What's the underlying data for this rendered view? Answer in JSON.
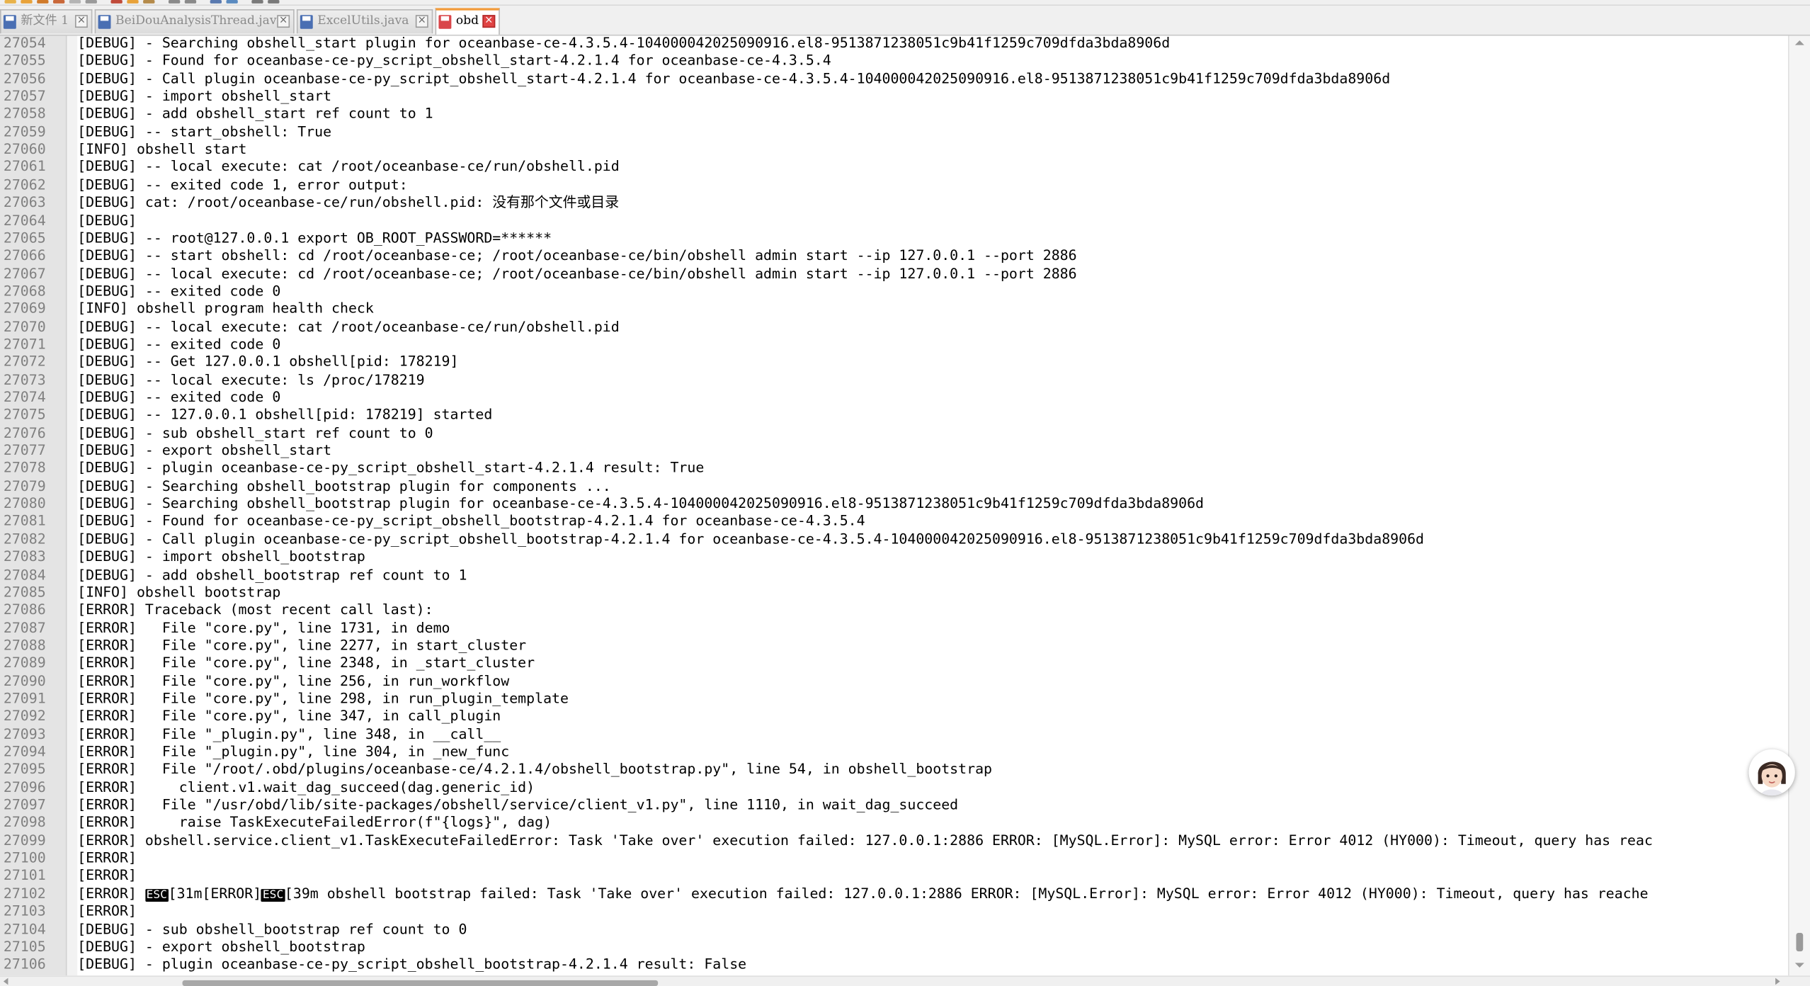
{
  "tabs": [
    {
      "label": "新文件  1",
      "state": "unsaved-icon-saved",
      "icon": "save-disk-icon",
      "active": false
    },
    {
      "label": "BeiDouAnalysisThread.java",
      "icon": "save-disk-icon",
      "active": false
    },
    {
      "label": "ExcelUtils.java",
      "icon": "save-disk-icon",
      "active": false
    },
    {
      "label": "obd",
      "icon": "unsaved-disk-icon",
      "active": true
    }
  ],
  "colors": {
    "active_tab_accent": "#f29b3a",
    "unsaved_icon": "#d9464a",
    "saved_icon": "#4a6fb3",
    "gutter": "#e4e4e4",
    "line_number": "#808080",
    "text": "#000000"
  },
  "esc_label": "ESC",
  "editor": {
    "lines": [
      {
        "n": "27054",
        "text": "[DEBUG] - Searching obshell_start plugin for oceanbase-ce-4.3.5.4-104000042025090916.el8-9513871238051c9b41f1259c709dfda3bda8906d"
      },
      {
        "n": "27055",
        "text": "[DEBUG] - Found for oceanbase-ce-py_script_obshell_start-4.2.1.4 for oceanbase-ce-4.3.5.4"
      },
      {
        "n": "27056",
        "text": "[DEBUG] - Call plugin oceanbase-ce-py_script_obshell_start-4.2.1.4 for oceanbase-ce-4.3.5.4-104000042025090916.el8-9513871238051c9b41f1259c709dfda3bda8906d"
      },
      {
        "n": "27057",
        "text": "[DEBUG] - import obshell_start"
      },
      {
        "n": "27058",
        "text": "[DEBUG] - add obshell_start ref count to 1"
      },
      {
        "n": "27059",
        "text": "[DEBUG] -- start_obshell: True"
      },
      {
        "n": "27060",
        "text": "[INFO] obshell start"
      },
      {
        "n": "27061",
        "text": "[DEBUG] -- local execute: cat /root/oceanbase-ce/run/obshell.pid"
      },
      {
        "n": "27062",
        "text": "[DEBUG] -- exited code 1, error output:"
      },
      {
        "n": "27063",
        "text": "[DEBUG] cat: /root/oceanbase-ce/run/obshell.pid: 没有那个文件或目录"
      },
      {
        "n": "27064",
        "text": "[DEBUG]"
      },
      {
        "n": "27065",
        "text": "[DEBUG] -- root@127.0.0.1 export OB_ROOT_PASSWORD=******"
      },
      {
        "n": "27066",
        "text": "[DEBUG] -- start obshell: cd /root/oceanbase-ce; /root/oceanbase-ce/bin/obshell admin start --ip 127.0.0.1 --port 2886"
      },
      {
        "n": "27067",
        "text": "[DEBUG] -- local execute: cd /root/oceanbase-ce; /root/oceanbase-ce/bin/obshell admin start --ip 127.0.0.1 --port 2886"
      },
      {
        "n": "27068",
        "text": "[DEBUG] -- exited code 0"
      },
      {
        "n": "27069",
        "text": "[INFO] obshell program health check"
      },
      {
        "n": "27070",
        "text": "[DEBUG] -- local execute: cat /root/oceanbase-ce/run/obshell.pid"
      },
      {
        "n": "27071",
        "text": "[DEBUG] -- exited code 0"
      },
      {
        "n": "27072",
        "text": "[DEBUG] -- Get 127.0.0.1 obshell[pid: 178219]"
      },
      {
        "n": "27073",
        "text": "[DEBUG] -- local execute: ls /proc/178219"
      },
      {
        "n": "27074",
        "text": "[DEBUG] -- exited code 0"
      },
      {
        "n": "27075",
        "text": "[DEBUG] -- 127.0.0.1 obshell[pid: 178219] started"
      },
      {
        "n": "27076",
        "text": "[DEBUG] - sub obshell_start ref count to 0"
      },
      {
        "n": "27077",
        "text": "[DEBUG] - export obshell_start"
      },
      {
        "n": "27078",
        "text": "[DEBUG] - plugin oceanbase-ce-py_script_obshell_start-4.2.1.4 result: True"
      },
      {
        "n": "27079",
        "text": "[DEBUG] - Searching obshell_bootstrap plugin for components ..."
      },
      {
        "n": "27080",
        "text": "[DEBUG] - Searching obshell_bootstrap plugin for oceanbase-ce-4.3.5.4-104000042025090916.el8-9513871238051c9b41f1259c709dfda3bda8906d"
      },
      {
        "n": "27081",
        "text": "[DEBUG] - Found for oceanbase-ce-py_script_obshell_bootstrap-4.2.1.4 for oceanbase-ce-4.3.5.4"
      },
      {
        "n": "27082",
        "text": "[DEBUG] - Call plugin oceanbase-ce-py_script_obshell_bootstrap-4.2.1.4 for oceanbase-ce-4.3.5.4-104000042025090916.el8-9513871238051c9b41f1259c709dfda3bda8906d"
      },
      {
        "n": "27083",
        "text": "[DEBUG] - import obshell_bootstrap"
      },
      {
        "n": "27084",
        "text": "[DEBUG] - add obshell_bootstrap ref count to 1"
      },
      {
        "n": "27085",
        "text": "[INFO] obshell bootstrap"
      },
      {
        "n": "27086",
        "text": "[ERROR] Traceback (most recent call last):"
      },
      {
        "n": "27087",
        "text": "[ERROR]   File \"core.py\", line 1731, in demo"
      },
      {
        "n": "27088",
        "text": "[ERROR]   File \"core.py\", line 2277, in start_cluster"
      },
      {
        "n": "27089",
        "text": "[ERROR]   File \"core.py\", line 2348, in _start_cluster"
      },
      {
        "n": "27090",
        "text": "[ERROR]   File \"core.py\", line 256, in run_workflow"
      },
      {
        "n": "27091",
        "text": "[ERROR]   File \"core.py\", line 298, in run_plugin_template"
      },
      {
        "n": "27092",
        "text": "[ERROR]   File \"core.py\", line 347, in call_plugin"
      },
      {
        "n": "27093",
        "text": "[ERROR]   File \"_plugin.py\", line 348, in __call__"
      },
      {
        "n": "27094",
        "text": "[ERROR]   File \"_plugin.py\", line 304, in _new_func"
      },
      {
        "n": "27095",
        "text": "[ERROR]   File \"/root/.obd/plugins/oceanbase-ce/4.2.1.4/obshell_bootstrap.py\", line 54, in obshell_bootstrap"
      },
      {
        "n": "27096",
        "text": "[ERROR]     client.v1.wait_dag_succeed(dag.generic_id)"
      },
      {
        "n": "27097",
        "text": "[ERROR]   File \"/usr/obd/lib/site-packages/obshell/service/client_v1.py\", line 1110, in wait_dag_succeed"
      },
      {
        "n": "27098",
        "text": "[ERROR]     raise TaskExecuteFailedError(f\"{logs}\", dag)"
      },
      {
        "n": "27099",
        "text": "[ERROR] obshell.service.client_v1.TaskExecuteFailedError: Task 'Take over' execution failed: 127.0.0.1:2886 ERROR: [MySQL.Error]: MySQL error: Error 4012 (HY000): Timeout, query has reac"
      },
      {
        "n": "27100",
        "text": "[ERROR]"
      },
      {
        "n": "27101",
        "text": "[ERROR]"
      },
      {
        "n": "27102",
        "prefix": "[ERROR] ",
        "esc1_after": "[31m[ERROR]",
        "esc2_after": "[39m obshell bootstrap failed: Task 'Take over' execution failed: 127.0.0.1:2886 ERROR: [MySQL.Error]: MySQL error: Error 4012 (HY000): Timeout, query has reache"
      },
      {
        "n": "27103",
        "text": "[ERROR]"
      },
      {
        "n": "27104",
        "text": "[DEBUG] - sub obshell_bootstrap ref count to 0"
      },
      {
        "n": "27105",
        "text": "[DEBUG] - export obshell_bootstrap"
      },
      {
        "n": "27106",
        "text": "[DEBUG] - plugin oceanbase-ce-py_script_obshell_bootstrap-4.2.1.4 result: False"
      }
    ]
  }
}
